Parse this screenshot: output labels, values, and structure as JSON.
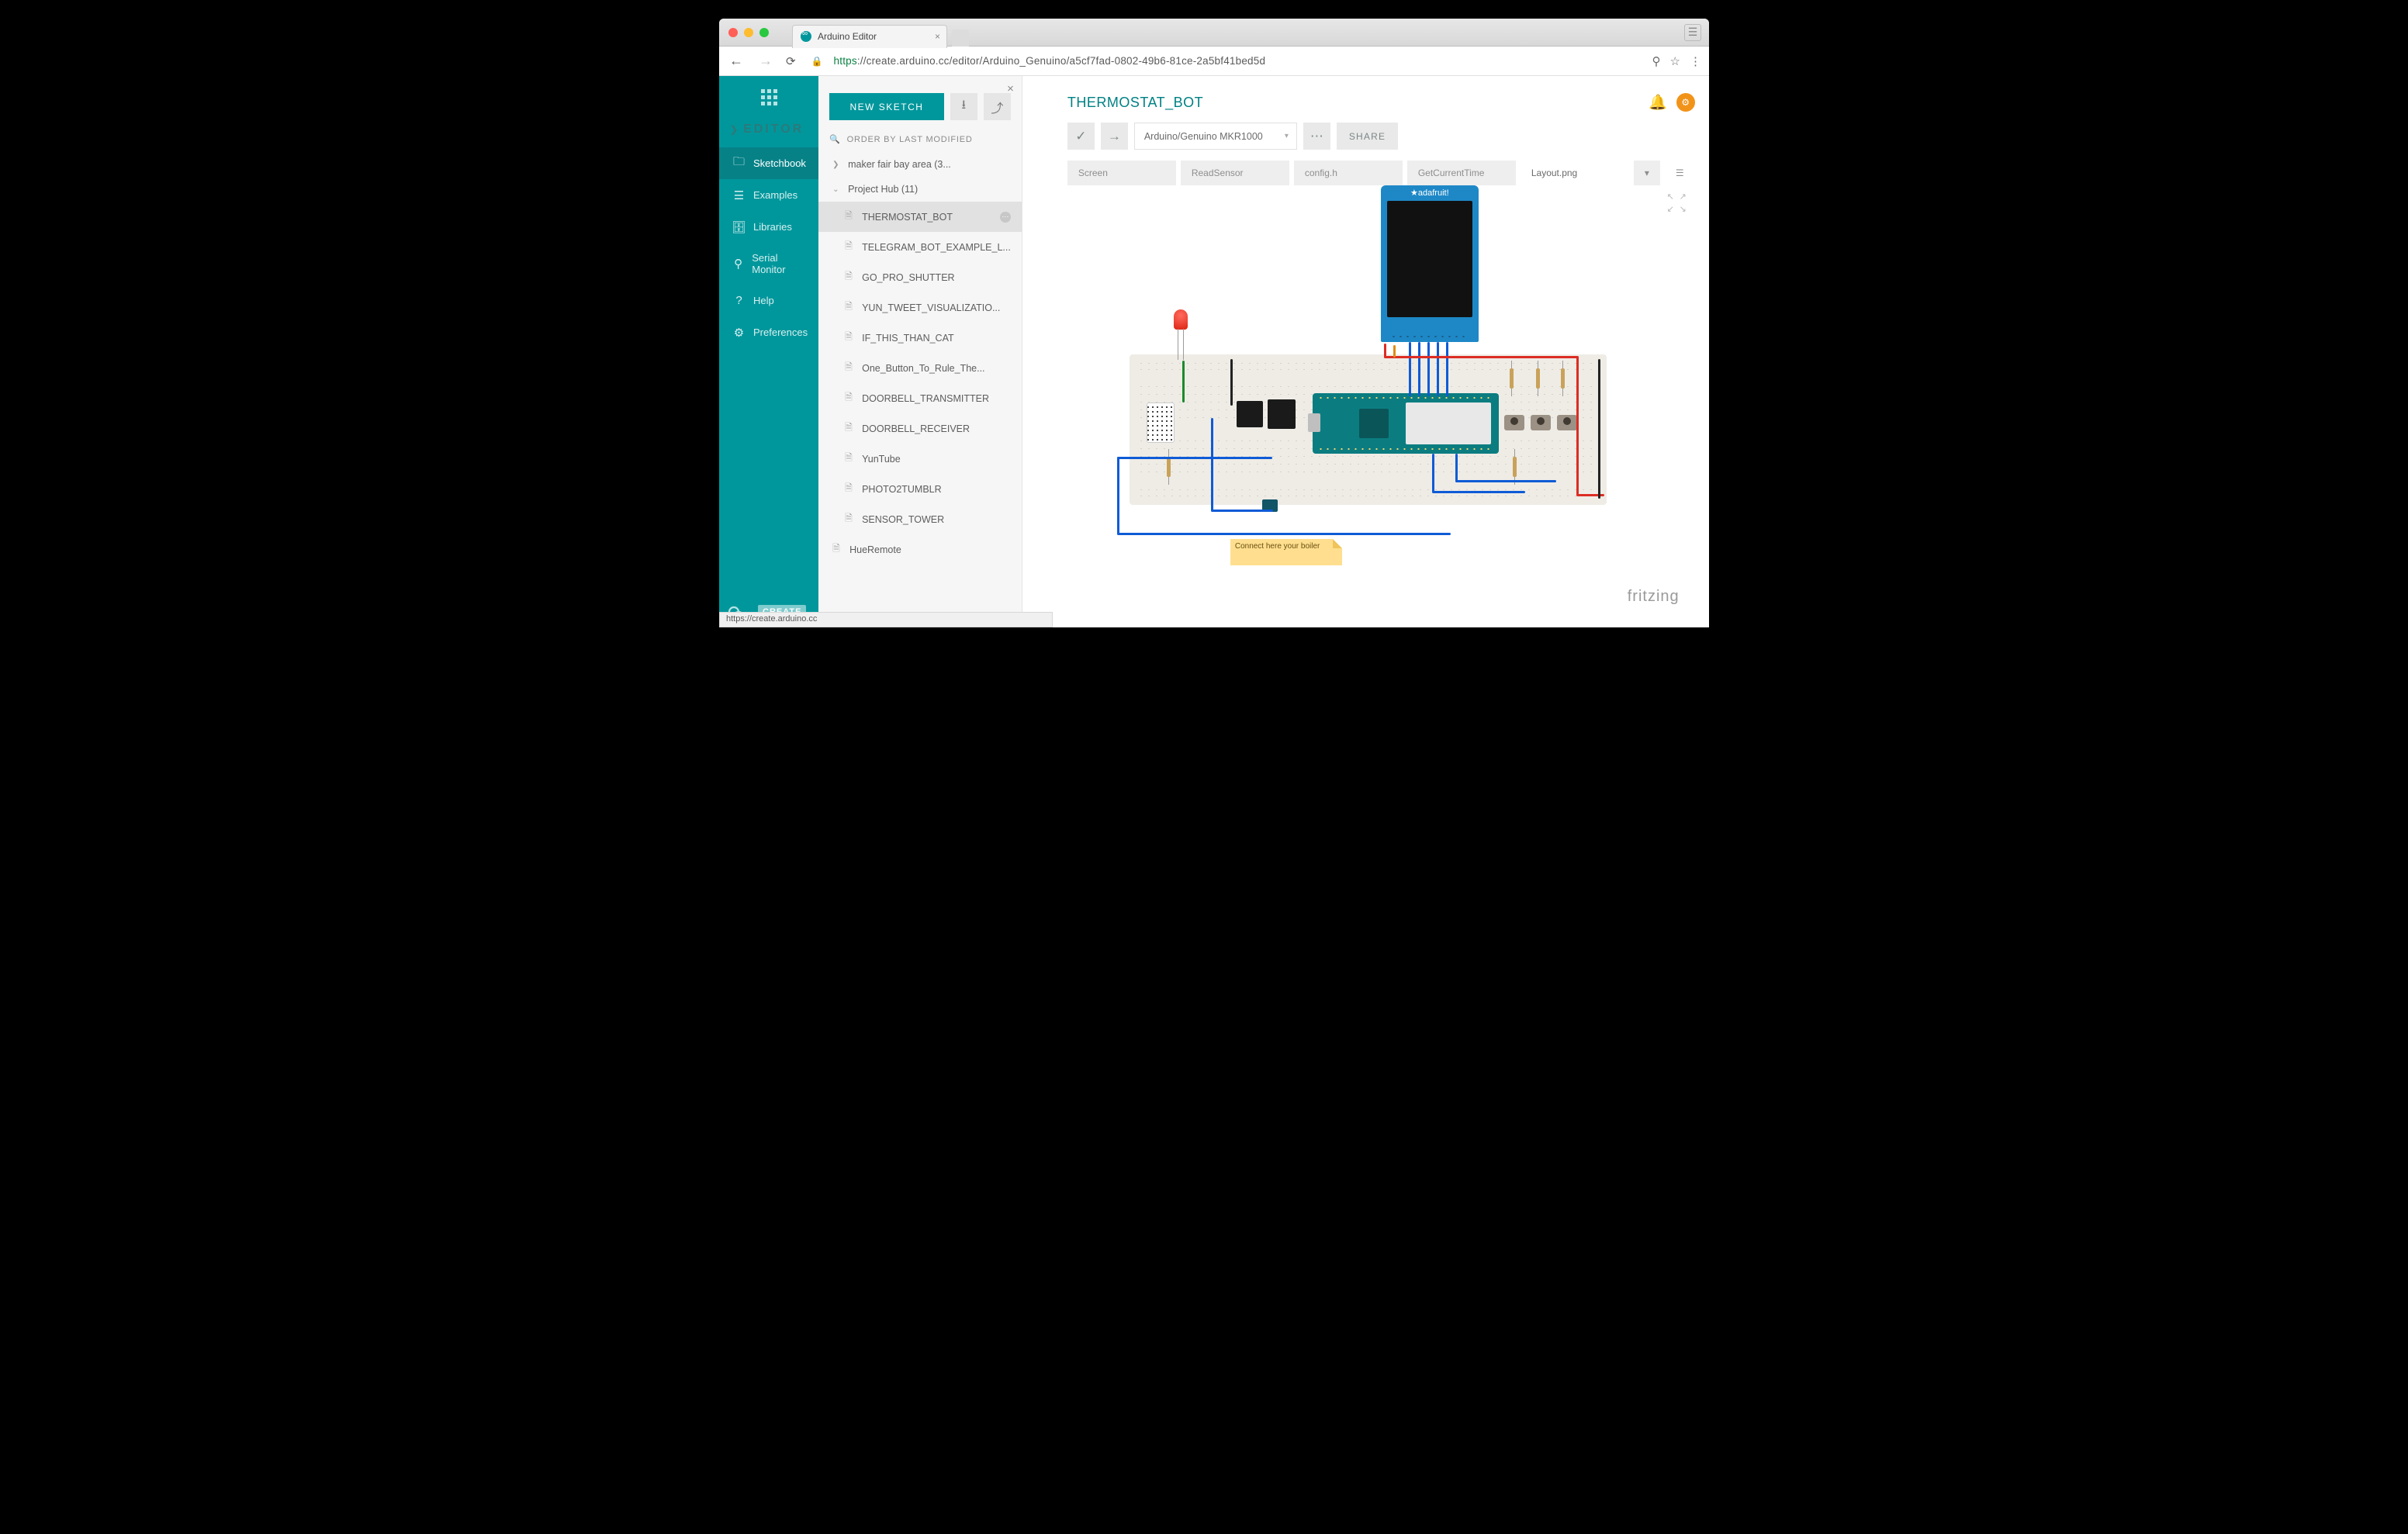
{
  "browser": {
    "tab_title": "Arduino Editor",
    "url_https": "https",
    "url_rest": "://create.arduino.cc/editor/Arduino_Genuino/a5cf7fad-0802-49b6-81ce-2a5bf41bed5d",
    "status_url": "https://create.arduino.cc"
  },
  "sidebar": {
    "editor_label": "EDITOR",
    "items": [
      {
        "label": "Sketchbook",
        "icon": "folder"
      },
      {
        "label": "Examples",
        "icon": "list"
      },
      {
        "label": "Libraries",
        "icon": "box"
      },
      {
        "label": "Serial Monitor",
        "icon": "magnify"
      },
      {
        "label": "Help",
        "icon": "help"
      },
      {
        "label": "Preferences",
        "icon": "sliders"
      }
    ],
    "create_badge": "CREATE"
  },
  "panel": {
    "new_sketch": "NEW SKETCH",
    "order_label": "ORDER BY LAST MODIFIED",
    "folders": [
      {
        "label": "maker fair bay area (3...",
        "open": false
      },
      {
        "label": "Project Hub (11)",
        "open": true
      }
    ],
    "sketches": [
      "THERMOSTAT_BOT",
      "TELEGRAM_BOT_EXAMPLE_L...",
      "GO_PRO_SHUTTER",
      "YUN_TWEET_VISUALIZATIO...",
      "IF_THIS_THAN_CAT",
      "One_Button_To_Rule_The...",
      "DOORBELL_TRANSMITTER",
      "DOORBELL_RECEIVER",
      "YunTube",
      "PHOTO2TUMBLR",
      "SENSOR_TOWER"
    ],
    "root_sketch": "HueRemote"
  },
  "project": {
    "title": "THERMOSTAT_BOT",
    "board": "Arduino/Genuino MKR1000",
    "share": "SHARE",
    "tabs": [
      "Screen",
      "ReadSensor",
      "config.h",
      "GetCurrentTime",
      "Layout.png"
    ],
    "active_tab": 4
  },
  "circuit": {
    "display_brand": "★adafruit!",
    "note": "Connect here your boiler",
    "credit": "fritzing"
  }
}
